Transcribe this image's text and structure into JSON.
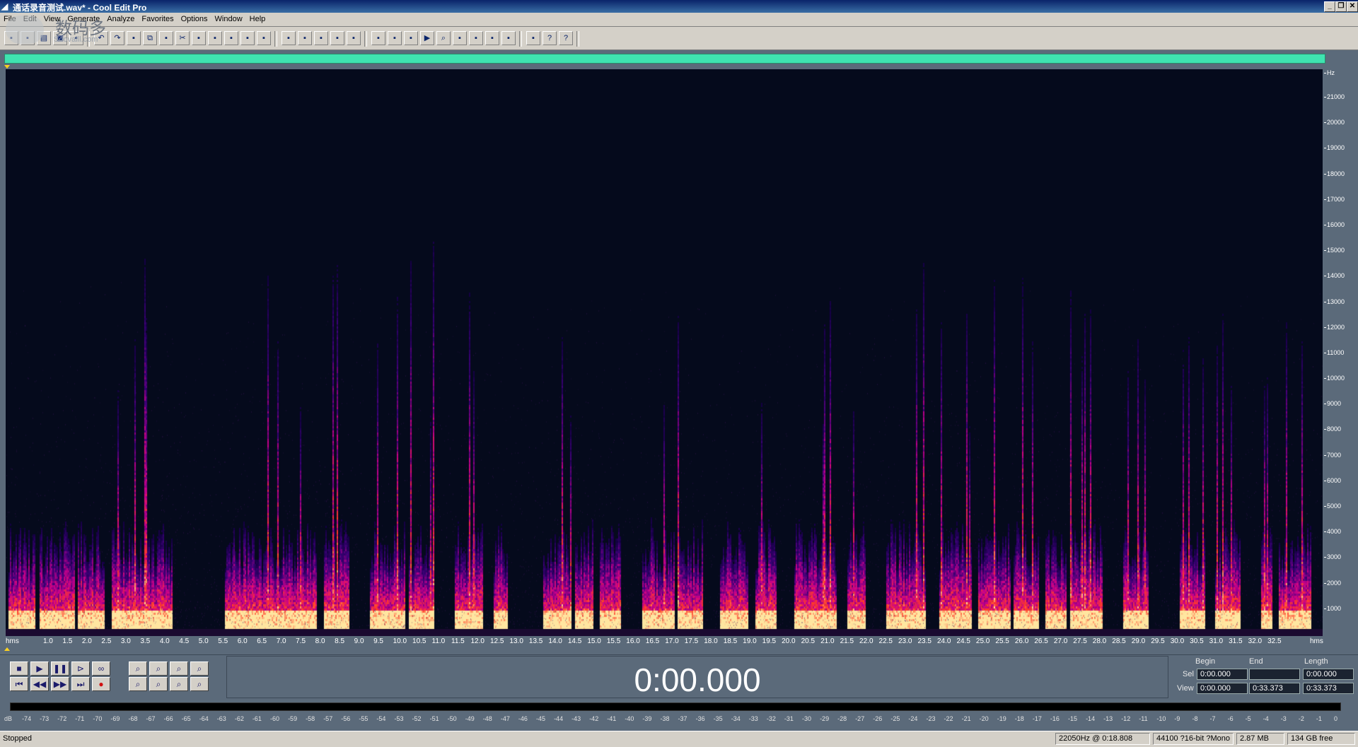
{
  "window": {
    "title": "通话录音测试.wav* - Cool Edit Pro",
    "buttons": [
      "_",
      "❐",
      "✕"
    ]
  },
  "watermark": {
    "line1": "数码多",
    "line2": "Soovalll.com"
  },
  "menu": [
    "File",
    "Edit",
    "View",
    "Generate",
    "Analyze",
    "Favorites",
    "Options",
    "Window",
    "Help"
  ],
  "toolbar": {
    "groups": [
      {
        "buttons": [
          "multitrack-icon",
          "waveform-icon",
          "open-icon",
          "save-icon",
          "save-as-icon"
        ]
      },
      {
        "buttons": [
          "undo-icon",
          "redo-icon",
          "repeat-icon",
          "copy-icon",
          "copy-to-new-icon",
          "cut-icon",
          "paste-icon",
          "paste-to-new-icon",
          "mix-paste-icon",
          "trim-icon",
          "mute-icon"
        ]
      },
      {
        "buttons": [
          "spectral-view-icon",
          "waveform-view-icon",
          "edit-left-icon",
          "edit-right-icon",
          "edit-both-icon"
        ]
      },
      {
        "buttons": [
          "cue-list-icon",
          "play-list-icon",
          "info-icon",
          "play-icon",
          "zoom-icon",
          "time-format-icon",
          "snap-icon",
          "marker-icon",
          "settings-icon"
        ]
      },
      {
        "buttons": [
          "scripts-icon",
          "help-icon",
          "whats-this-icon"
        ]
      }
    ]
  },
  "frequency_axis": {
    "unit": "Hz",
    "labels": [
      "21000",
      "20000",
      "19000",
      "18000",
      "17000",
      "16000",
      "15000",
      "14000",
      "13000",
      "12000",
      "11000",
      "10000",
      "9000",
      "8000",
      "7000",
      "6000",
      "5000",
      "4000",
      "3000",
      "2000",
      "1000"
    ]
  },
  "time_axis": {
    "start_label": "hms",
    "end_label": "hms",
    "labels": [
      "1.0",
      "1.5",
      "2.0",
      "2.5",
      "3.0",
      "3.5",
      "4.0",
      "4.5",
      "5.0",
      "5.5",
      "6.0",
      "6.5",
      "7.0",
      "7.5",
      "8.0",
      "8.5",
      "9.0",
      "9.5",
      "10.0",
      "10.5",
      "11.0",
      "11.5",
      "12.0",
      "12.5",
      "13.0",
      "13.5",
      "14.0",
      "14.5",
      "15.0",
      "15.5",
      "16.0",
      "16.5",
      "17.0",
      "17.5",
      "18.0",
      "18.5",
      "19.0",
      "19.5",
      "20.0",
      "20.5",
      "21.0",
      "21.5",
      "22.0",
      "22.5",
      "23.0",
      "23.5",
      "24.0",
      "24.5",
      "25.0",
      "25.5",
      "26.0",
      "26.5",
      "27.0",
      "27.5",
      "28.0",
      "28.5",
      "29.0",
      "29.5",
      "30.0",
      "30.5",
      "31.0",
      "31.5",
      "32.0",
      "32.5"
    ]
  },
  "transport": {
    "buttons": [
      "stop-icon",
      "play-icon",
      "pause-icon",
      "play-to-end-icon",
      "loop-icon",
      "go-to-start-icon",
      "rewind-icon",
      "fast-forward-icon",
      "go-to-end-icon",
      "record-icon"
    ],
    "zoom_buttons": [
      "zoom-in-horizontal-icon",
      "zoom-out-horizontal-icon",
      "zoom-out-full-icon",
      "zoom-in-vertical-icon",
      "zoom-in-left-icon",
      "zoom-in-right-icon",
      "zoom-selection-icon",
      "zoom-out-vertical-icon"
    ]
  },
  "time_display": "0:00.000",
  "selection": {
    "headers": {
      "begin": "Begin",
      "end": "End",
      "length": "Length"
    },
    "sel": {
      "label": "Sel",
      "begin": "0:00.000",
      "end": "",
      "length": "0:00.000"
    },
    "view": {
      "label": "View",
      "begin": "0:00.000",
      "end": "0:33.373",
      "length": "0:33.373"
    }
  },
  "level_meter": {
    "labels": [
      "dB",
      "-74",
      "-73",
      "-72",
      "-71",
      "-70",
      "-69",
      "-68",
      "-67",
      "-66",
      "-65",
      "-64",
      "-63",
      "-62",
      "-61",
      "-60",
      "-59",
      "-58",
      "-57",
      "-56",
      "-55",
      "-54",
      "-53",
      "-52",
      "-51",
      "-50",
      "-49",
      "-48",
      "-47",
      "-46",
      "-45",
      "-44",
      "-43",
      "-42",
      "-41",
      "-40",
      "-39",
      "-38",
      "-37",
      "-36",
      "-35",
      "-34",
      "-33",
      "-32",
      "-31",
      "-30",
      "-29",
      "-28",
      "-27",
      "-26",
      "-25",
      "-24",
      "-23",
      "-22",
      "-21",
      "-20",
      "-19",
      "-18",
      "-17",
      "-16",
      "-15",
      "-14",
      "-13",
      "-12",
      "-11",
      "-10",
      "-9",
      "-8",
      "-7",
      "-6",
      "-5",
      "-4",
      "-3",
      "-2",
      "-1",
      "0"
    ]
  },
  "status": {
    "state": "Stopped",
    "cursor": "22050Hz @  0:18.808",
    "format": "44100 ?16-bit ?Mono",
    "size": "2.87 MB",
    "free": "134 GB free"
  },
  "colors": {
    "overview": "#3fe3b0",
    "spectrogram_bg": "#050a1c",
    "panel_bg": "#5b6a7a"
  }
}
